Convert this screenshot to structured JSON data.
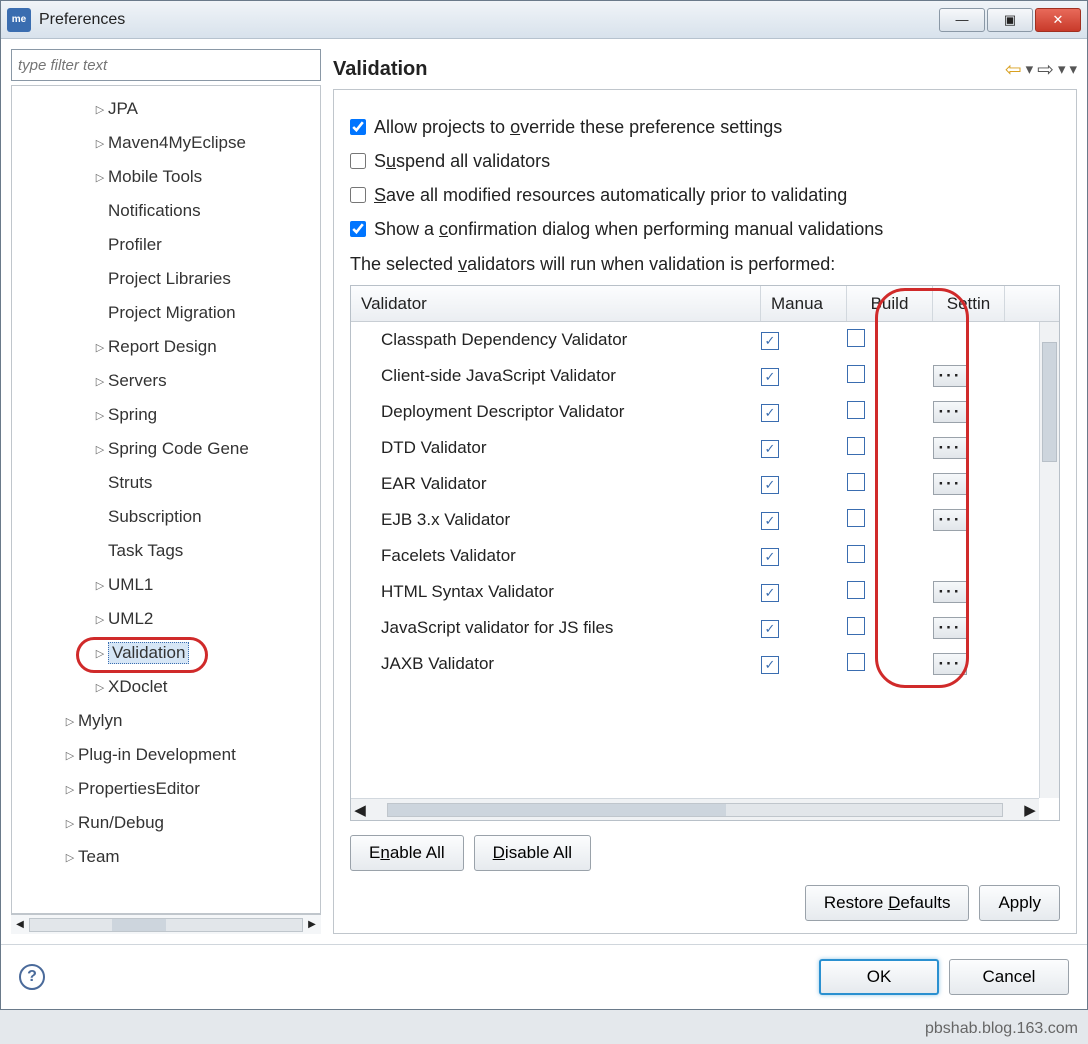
{
  "title": "Preferences",
  "filter_placeholder": "type filter text",
  "tree": [
    {
      "label": "JPA",
      "depth": 2,
      "hasChildren": true
    },
    {
      "label": "Maven4MyEclipse",
      "depth": 2,
      "hasChildren": true
    },
    {
      "label": "Mobile Tools",
      "depth": 2,
      "hasChildren": true
    },
    {
      "label": "Notifications",
      "depth": 2,
      "hasChildren": false
    },
    {
      "label": "Profiler",
      "depth": 2,
      "hasChildren": false
    },
    {
      "label": "Project Libraries",
      "depth": 2,
      "hasChildren": false
    },
    {
      "label": "Project Migration",
      "depth": 2,
      "hasChildren": false
    },
    {
      "label": "Report Design",
      "depth": 2,
      "hasChildren": true
    },
    {
      "label": "Servers",
      "depth": 2,
      "hasChildren": true
    },
    {
      "label": "Spring",
      "depth": 2,
      "hasChildren": true
    },
    {
      "label": "Spring Code Gene",
      "depth": 2,
      "hasChildren": true
    },
    {
      "label": "Struts",
      "depth": 2,
      "hasChildren": false
    },
    {
      "label": "Subscription",
      "depth": 2,
      "hasChildren": false
    },
    {
      "label": "Task Tags",
      "depth": 2,
      "hasChildren": false
    },
    {
      "label": "UML1",
      "depth": 2,
      "hasChildren": true
    },
    {
      "label": "UML2",
      "depth": 2,
      "hasChildren": true
    },
    {
      "label": "Validation",
      "depth": 2,
      "hasChildren": true,
      "selected": true
    },
    {
      "label": "XDoclet",
      "depth": 2,
      "hasChildren": true
    },
    {
      "label": "Mylyn",
      "depth": 1,
      "hasChildren": true
    },
    {
      "label": "Plug-in Development",
      "depth": 1,
      "hasChildren": true
    },
    {
      "label": "PropertiesEditor",
      "depth": 1,
      "hasChildren": true
    },
    {
      "label": "Run/Debug",
      "depth": 1,
      "hasChildren": true
    },
    {
      "label": "Team",
      "depth": 1,
      "hasChildren": true
    }
  ],
  "header": "Validation",
  "options": {
    "override": {
      "label": "Allow projects to override these preference settings",
      "checked": true
    },
    "suspend": {
      "label": "Suspend all validators",
      "checked": false
    },
    "save": {
      "label": "Save all modified resources automatically prior to validating",
      "checked": false
    },
    "confirm": {
      "label": "Show a confirmation dialog when performing manual validations",
      "checked": true
    }
  },
  "instruction": "The selected validators will run when validation is performed:",
  "columns": {
    "validator": "Validator",
    "manual": "Manua",
    "build": "Build",
    "settings": "Settin"
  },
  "rows": [
    {
      "name": "Classpath Dependency Validator",
      "manual": true,
      "build": false,
      "settings": false
    },
    {
      "name": "Client-side JavaScript Validator",
      "manual": true,
      "build": false,
      "settings": true
    },
    {
      "name": "Deployment Descriptor Validator",
      "manual": true,
      "build": false,
      "settings": true
    },
    {
      "name": "DTD Validator",
      "manual": true,
      "build": false,
      "settings": true
    },
    {
      "name": "EAR Validator",
      "manual": true,
      "build": false,
      "settings": true
    },
    {
      "name": "EJB 3.x Validator",
      "manual": true,
      "build": false,
      "settings": true
    },
    {
      "name": "Facelets Validator",
      "manual": true,
      "build": false,
      "settings": false
    },
    {
      "name": "HTML Syntax Validator",
      "manual": true,
      "build": false,
      "settings": true
    },
    {
      "name": "JavaScript validator for JS files",
      "manual": true,
      "build": false,
      "settings": true
    },
    {
      "name": "JAXB Validator",
      "manual": true,
      "build": false,
      "settings": true
    }
  ],
  "buttons": {
    "enable_all": "Enable All",
    "disable_all": "Disable All",
    "restore": "Restore Defaults",
    "apply": "Apply",
    "ok": "OK",
    "cancel": "Cancel"
  },
  "watermark": "pbshab.blog.163.com"
}
